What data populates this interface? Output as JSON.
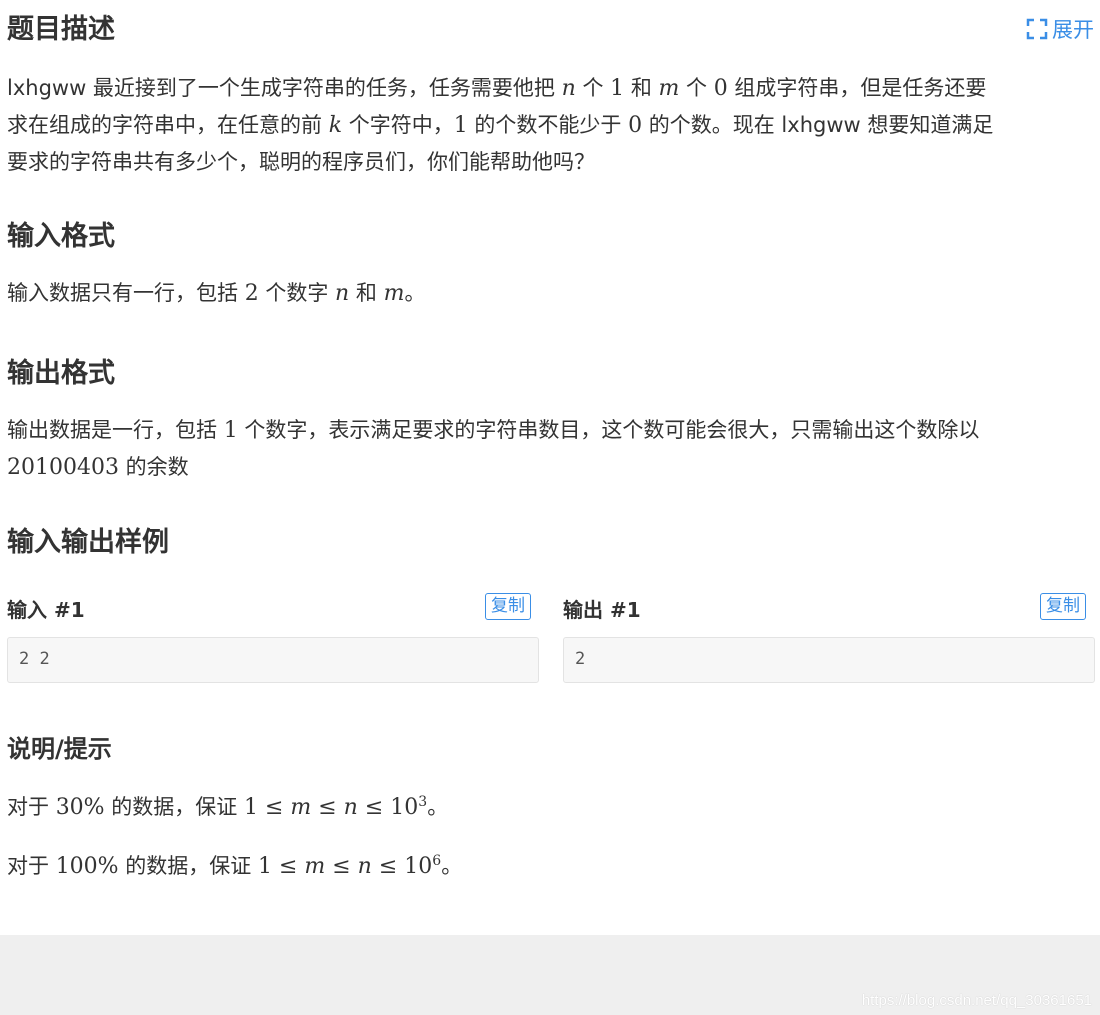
{
  "description": {
    "heading": "题目描述",
    "expand_label": "展开",
    "p1": "lxhgww 最近接到了一个生成字符串的任务，任务需要他把 ",
    "p2": " 个 ",
    "p3": " 和 ",
    "p4": " 个 ",
    "p5": " 组成字符串，但是任务还要",
    "p6": "求在组成的字符串中，在任意的前 ",
    "p7": " 个字符中，",
    "p8": " 的个数不能少于 ",
    "p9": " 的个数。现在 lxhgww 想要知道满足",
    "p10": "要求的字符串共有多少个，聪明的程序员们，你们能帮助他吗？",
    "var_n": "n",
    "var_m": "m",
    "var_k": "k",
    "one": "1",
    "zero": "0"
  },
  "input_format": {
    "heading": "输入格式",
    "t1": "输入数据只有一行，包括 ",
    "num": "2",
    "t2": " 个数字 ",
    "n": "n",
    "t3": " 和 ",
    "m": "m",
    "t4": "。"
  },
  "output_format": {
    "heading": "输出格式",
    "t1": "输出数据是一行，包括 ",
    "num": "1",
    "t2": " 个数字，表示满足要求的字符串数目，这个数可能会很大，只需输出这个数除以",
    "mod": "20100403",
    "t3": " 的余数"
  },
  "samples": {
    "heading": "输入输出样例",
    "input_label": "输入 #1",
    "output_label": "输出 #1",
    "copy_label": "复制",
    "input_value": "2 2",
    "output_value": "2"
  },
  "hints": {
    "heading": "说明/提示",
    "l1_a": "对于 ",
    "l1_pct": "30%",
    "l1_b": " 的数据，保证 ",
    "l1_math": "1 ≤ ",
    "l1_m": "m",
    "le": " ≤ ",
    "l1_n": "n",
    "l1_base": "10",
    "l1_exp": "3",
    "end": "。",
    "l2_a": "对于 ",
    "l2_pct": "100%",
    "l2_b": " 的数据，保证 ",
    "l2_exp": "6"
  },
  "watermark": "https://blog.csdn.net/qq_30361651",
  "colors": {
    "accent": "#3a8ee6",
    "text": "#333333",
    "codebox_bg": "#f7f7f7",
    "footer_bg": "#efefef"
  }
}
